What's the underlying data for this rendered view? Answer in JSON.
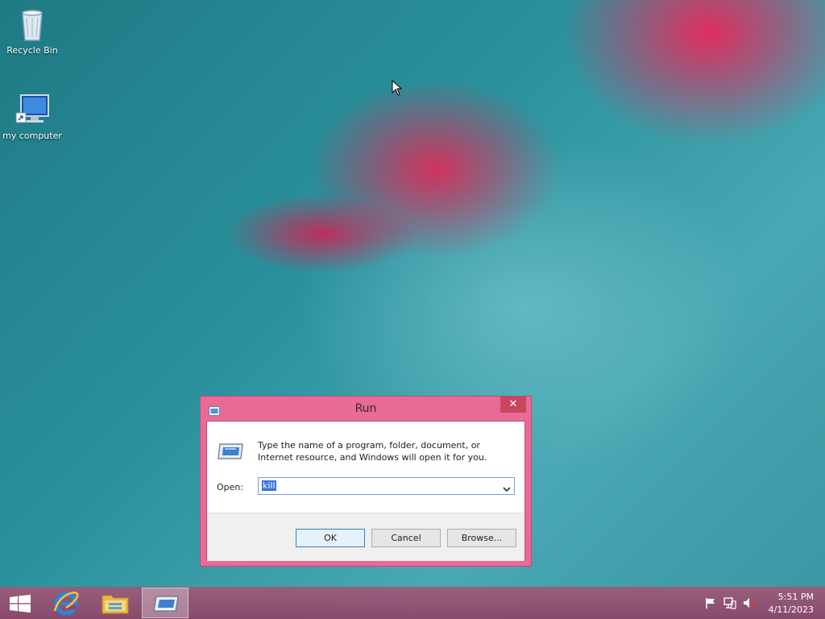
{
  "desktop": {
    "icons": [
      {
        "label": "Recycle Bin",
        "icon": "recycle-bin-icon"
      },
      {
        "label": "my computer",
        "icon": "computer-icon"
      }
    ]
  },
  "run_dialog": {
    "title": "Run",
    "close_glyph": "✕",
    "description": "Type the name of a program, folder, document, or Internet resource, and Windows will open it for you.",
    "open_label": "Open:",
    "open_value": "kill",
    "buttons": {
      "ok": "OK",
      "cancel": "Cancel",
      "browse": "Browse..."
    }
  },
  "taskbar": {
    "items": [
      {
        "name": "start",
        "icon": "windows-logo-icon"
      },
      {
        "name": "internet-explorer",
        "icon": "internet-explorer-icon"
      },
      {
        "name": "file-explorer",
        "icon": "folder-icon"
      },
      {
        "name": "run",
        "icon": "run-icon",
        "active": true
      }
    ],
    "clock": {
      "time": "5:51 PM",
      "date": "4/11/2023"
    }
  },
  "colors": {
    "dialog_frame": "#e86a96",
    "close_button": "#c7475f",
    "taskbar": "#8c4669",
    "selection": "#3a74d8"
  }
}
